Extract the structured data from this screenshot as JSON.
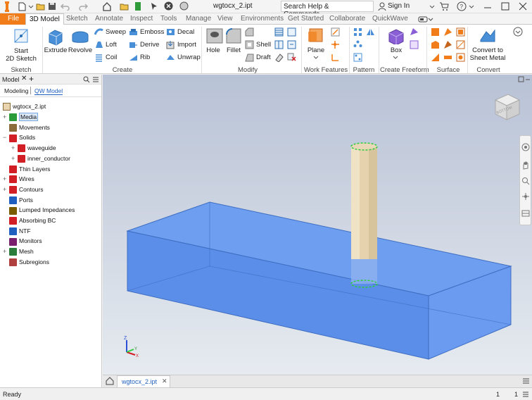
{
  "app": {
    "title": "wgtocx_2.ipt",
    "search_placeholder": "Search Help & Commands...",
    "sign_in": "Sign In"
  },
  "tabs": [
    "File",
    "3D Model",
    "Sketch",
    "Annotate",
    "Inspect",
    "Tools",
    "Manage",
    "View",
    "Environments",
    "Get Started",
    "Collaborate",
    "QuickWave"
  ],
  "active_tab": "3D Model",
  "ribbon": {
    "sketch": {
      "label": "Sketch",
      "start_line1": "Start",
      "start_line2": "2D Sketch"
    },
    "create": {
      "label": "Create",
      "extrude": "Extrude",
      "revolve": "Revolve",
      "sweep": "Sweep",
      "loft": "Loft",
      "coil": "Coil",
      "emboss": "Emboss",
      "derive": "Derive",
      "rib": "Rib",
      "decal": "Decal",
      "import": "Import",
      "unwrap": "Unwrap"
    },
    "modify": {
      "label": "Modify",
      "hole": "Hole",
      "fillet": "Fillet",
      "shell": "Shell",
      "draft": "Draft"
    },
    "work_features": {
      "label": "Work Features",
      "plane": "Plane"
    },
    "pattern": {
      "label": "Pattern"
    },
    "freeform": {
      "label": "Create Freeform",
      "box": "Box"
    },
    "surface": {
      "label": "Surface"
    },
    "convert": {
      "label": "Convert",
      "line1": "Convert to",
      "line2": "Sheet Metal"
    }
  },
  "browser": {
    "title": "Model",
    "tab_modeling": "Modeling",
    "tab_qw": "QW Model",
    "root": "wgtocx_2.ipt",
    "items": [
      {
        "label": "Media",
        "expand": "+",
        "icon_color": "#2a9d3a",
        "highlight": true
      },
      {
        "label": "Movements",
        "expand": "",
        "icon_color": "#8a6d3b"
      },
      {
        "label": "Solids",
        "expand": "−",
        "icon_color": "#d21f26"
      },
      {
        "label": "waveguide",
        "expand": "+",
        "icon_color": "#d21f26"
      },
      {
        "label": "inner_conductor",
        "expand": "+",
        "icon_color": "#d21f26"
      },
      {
        "label": "Thin Layers",
        "expand": "",
        "icon_color": "#d21f26"
      },
      {
        "label": "Wires",
        "expand": "+",
        "icon_color": "#d21f26"
      },
      {
        "label": "Contours",
        "expand": "+",
        "icon_color": "#d21f26"
      },
      {
        "label": "Ports",
        "expand": "",
        "icon_color": "#1f5fbf"
      },
      {
        "label": "Lumped Impedances",
        "expand": "",
        "icon_color": "#7a5c00"
      },
      {
        "label": "Absorbing BC",
        "expand": "",
        "icon_color": "#d21f26"
      },
      {
        "label": "NTF",
        "expand": "",
        "icon_color": "#1f5fbf"
      },
      {
        "label": "Monitors",
        "expand": "",
        "icon_color": "#7a1f6e"
      },
      {
        "label": "Mesh",
        "expand": "+",
        "icon_color": "#2a7d3a"
      },
      {
        "label": "Subregions",
        "expand": "",
        "icon_color": "#b04040"
      }
    ]
  },
  "doc_tab": "wgtocx_2.ipt",
  "status": {
    "text": "Ready",
    "count1": "1",
    "count2": "1"
  },
  "viewcube_label": "BOTTOM",
  "axis": {
    "x": "X",
    "y": "Y",
    "z": "Z"
  },
  "colors": {
    "file_tab": "#f07d1a",
    "waveguide": "#5b8ee8",
    "conductor": "#e8d5b0",
    "selection": "#2ecc40"
  }
}
